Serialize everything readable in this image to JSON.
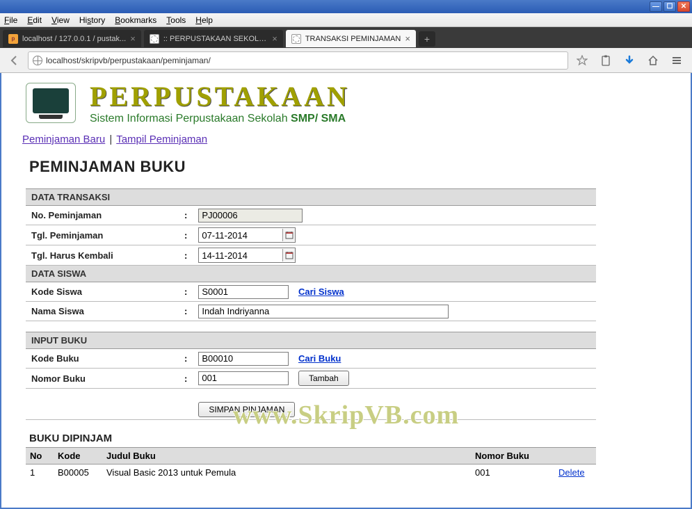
{
  "menu": {
    "file": "File",
    "edit": "Edit",
    "view": "View",
    "history": "History",
    "bookmarks": "Bookmarks",
    "tools": "Tools",
    "help": "Help"
  },
  "tabs": [
    {
      "label": "localhost / 127.0.0.1 / pustak...",
      "favicon": "pma"
    },
    {
      "label": ":: PERPUSTAKAAN SEKOLAH - Sist...",
      "favicon": "dash"
    },
    {
      "label": "TRANSAKSI PEMINJAMAN",
      "favicon": "dash",
      "active": true
    }
  ],
  "url": "localhost/skripvb/perpustakaan/peminjaman/",
  "header": {
    "title": "PERPUSTAKAAN",
    "subtitle_a": "Sistem Informasi Perpustakaan Sekolah ",
    "subtitle_b": "SMP/ SMA"
  },
  "links": {
    "new": "Peminjaman Baru",
    "show": "Tampil Peminjaman",
    "sep": "|"
  },
  "page_title": "PEMINJAMAN BUKU",
  "sections": {
    "transaksi": "DATA TRANSAKSI",
    "siswa": "DATA SISWA",
    "inputbuku": "INPUT BUKU"
  },
  "fields": {
    "no_peminjaman": {
      "label": "No. Peminjaman",
      "value": "PJ00006"
    },
    "tgl_peminjaman": {
      "label": "Tgl. Peminjaman",
      "value": "07-11-2014"
    },
    "tgl_kembali": {
      "label": "Tgl. Harus Kembali",
      "value": "14-11-2014"
    },
    "kode_siswa": {
      "label": "Kode Siswa",
      "value": "S0001",
      "link": "Cari Siswa"
    },
    "nama_siswa": {
      "label": "Nama Siswa",
      "value": "Indah Indriyanna"
    },
    "kode_buku": {
      "label": "Kode Buku",
      "value": "B00010",
      "link": "Cari Buku"
    },
    "nomor_buku": {
      "label": "Nomor Buku",
      "value": "001",
      "button": "Tambah"
    }
  },
  "buttons": {
    "simpan": "SIMPAN PINJAMAN"
  },
  "watermark": "www.SkripVB.com",
  "borrowed": {
    "heading": "BUKU DIPINJAM",
    "cols": {
      "no": "No",
      "kode": "Kode",
      "judul": "Judul Buku",
      "nomor": "Nomor Buku"
    },
    "rows": [
      {
        "no": "1",
        "kode": "B00005",
        "judul": "Visual Basic 2013 untuk Pemula",
        "nomor": "001",
        "action": "Delete"
      }
    ]
  }
}
